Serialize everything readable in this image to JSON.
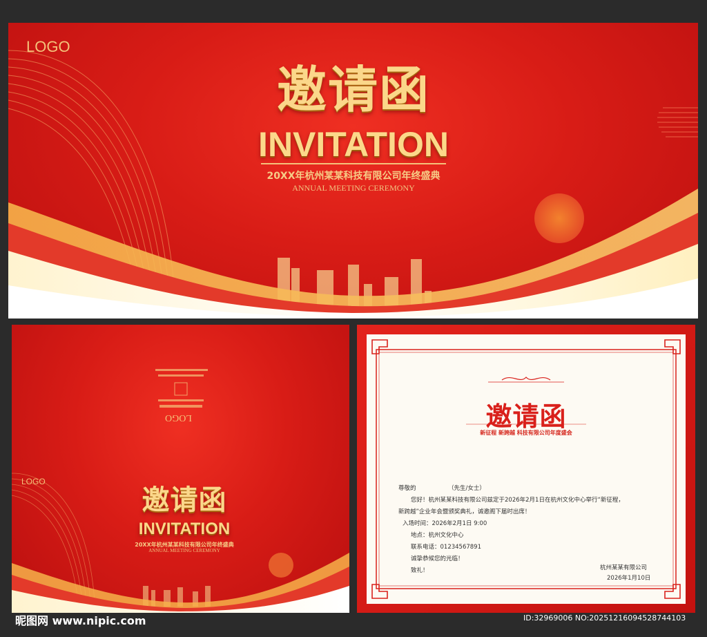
{
  "top": {
    "logo": "LOGO",
    "title_cn": "邀请函",
    "title_en": "INVITATION",
    "subtitle_cn": "20XX年杭州某某科技有限公司年终盛典",
    "subtitle_en": "ANNUAL MEETING CEREMONY"
  },
  "cover": {
    "logo": "LOGO",
    "back_logo": "LOGO",
    "title_cn": "邀请函",
    "title_en": "INVITATION",
    "subtitle_cn": "20XX年杭州某某科技有限公司年终盛典",
    "subtitle_en": "ANNUAL MEETING CEREMONY"
  },
  "card": {
    "title": "邀请函",
    "subtitle": "新征程 新跨越 科技有限公司年度盛会",
    "salutation": "尊敬的",
    "title_suffix": "（先生/女士）",
    "body_line1": "您好！杭州某某科技有限公司兹定于2026年2月1日在杭州文化中心举行“新征程，",
    "body_line2": "新跨越”企业年会暨颁奖典礼，诚邀阁下届时出席！",
    "time": "入场时间：2026年2月1日 9:00",
    "place": "地点：杭州文化中心",
    "phone": "联系电话：01234567891",
    "await": "诚挚恭候您的光临！",
    "regards": "致礼！",
    "company": "杭州某某有限公司",
    "date": "2026年1月10日"
  },
  "watermark": {
    "site": "昵图网 www.nipic.com",
    "id": "ID:32969006 NO:20251216094528744103"
  },
  "colors": {
    "red": "#d81c16",
    "gold": "#fbd78a",
    "card_bg": "#fdfaf3"
  }
}
